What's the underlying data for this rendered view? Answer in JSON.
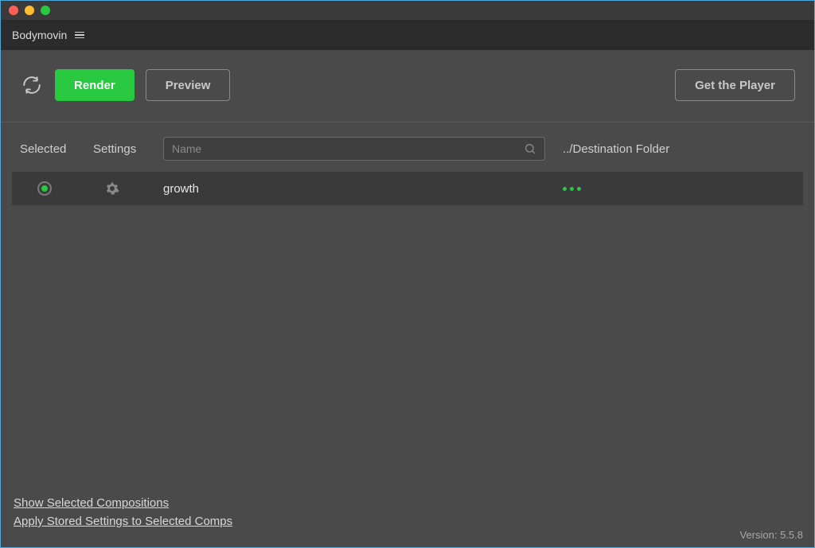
{
  "app": {
    "title": "Bodymovin"
  },
  "toolbar": {
    "render_label": "Render",
    "preview_label": "Preview",
    "get_player_label": "Get the Player"
  },
  "columns": {
    "selected": "Selected",
    "settings": "Settings",
    "destination": "../Destination Folder"
  },
  "search": {
    "placeholder": "Name",
    "value": ""
  },
  "rows": [
    {
      "name": "growth",
      "selected": true
    }
  ],
  "footer": {
    "show_selected": "Show Selected Compositions",
    "apply_stored": "Apply Stored Settings to Selected Comps"
  },
  "version_label": "Version: 5.5.8",
  "colors": {
    "accent": "#28c940"
  }
}
